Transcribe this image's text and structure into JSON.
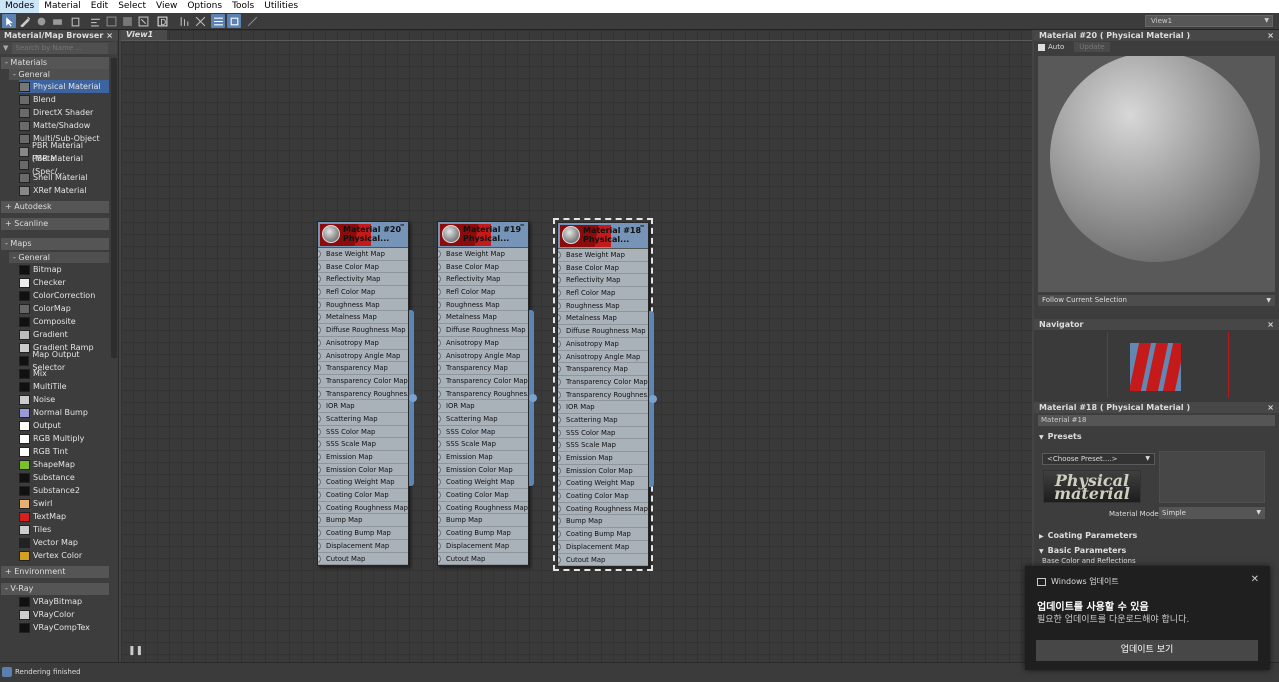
{
  "menubar": {
    "items": [
      "Modes",
      "Material",
      "Edit",
      "Select",
      "View",
      "Options",
      "Tools",
      "Utilities"
    ]
  },
  "toolbar": {
    "view_dropdown": "View1"
  },
  "browser": {
    "title": "Material/Map Browser",
    "search_placeholder": "Search by Name ...",
    "materials_label": "- Materials",
    "general_label": "- General",
    "materials": [
      {
        "label": "Physical Material",
        "color": "#777"
      },
      {
        "label": "Blend",
        "color": "#6a6a6a"
      },
      {
        "label": "DirectX Shader",
        "color": "#6a6a6a"
      },
      {
        "label": "Matte/Shadow",
        "color": "#6a6a6a"
      },
      {
        "label": "Multi/Sub-Object",
        "color": "#6a6a6a"
      },
      {
        "label": "PBR Material (Metal...",
        "color": "#888"
      },
      {
        "label": "PBR Material (Spec/...",
        "color": "#6a6a6a"
      },
      {
        "label": "Shell Material",
        "color": "#6a6a6a"
      },
      {
        "label": "XRef Material",
        "color": "#888"
      }
    ],
    "autodesk_label": "+ Autodesk",
    "scanline_label": "+ Scanline",
    "maps_label": "- Maps",
    "maps_general_label": "- General",
    "maps": [
      {
        "label": "Bitmap",
        "color": "#111"
      },
      {
        "label": "Checker",
        "color": "#eee"
      },
      {
        "label": "ColorCorrection",
        "color": "#111"
      },
      {
        "label": "ColorMap",
        "color": "#666"
      },
      {
        "label": "Composite",
        "color": "#111"
      },
      {
        "label": "Gradient",
        "color": "#bbb"
      },
      {
        "label": "Gradient Ramp",
        "color": "#ccc"
      },
      {
        "label": "Map Output Selector",
        "color": "#111"
      },
      {
        "label": "Mix",
        "color": "#111"
      },
      {
        "label": "MultiTile",
        "color": "#111"
      },
      {
        "label": "Noise",
        "color": "#ccc"
      },
      {
        "label": "Normal Bump",
        "color": "#9a9adb"
      },
      {
        "label": "Output",
        "color": "#fff"
      },
      {
        "label": "RGB Multiply",
        "color": "#fff"
      },
      {
        "label": "RGB Tint",
        "color": "#fff"
      },
      {
        "label": "ShapeMap",
        "color": "#7bbf2a"
      },
      {
        "label": "Substance",
        "color": "#111"
      },
      {
        "label": "Substance2",
        "color": "#111"
      },
      {
        "label": "Swirl",
        "color": "#e8b070"
      },
      {
        "label": "TextMap",
        "color": "#d52020"
      },
      {
        "label": "Tiles",
        "color": "#ccc"
      },
      {
        "label": "Vector Map",
        "color": "#222"
      },
      {
        "label": "Vertex Color",
        "color": "#d4a020"
      }
    ],
    "environment_label": "+ Environment",
    "vray_label": "- V-Ray",
    "vray": [
      {
        "label": "VRayBitmap",
        "color": "#111"
      },
      {
        "label": "VRayColor",
        "color": "#ccc"
      },
      {
        "label": "VRayCompTex",
        "color": "#111"
      }
    ]
  },
  "view": {
    "tab": "View1"
  },
  "slots": [
    "Base Weight Map",
    "Base Color Map",
    "Reflectivity Map",
    "Refl Color Map",
    "Roughness Map",
    "Metalness Map",
    "Diffuse Roughness Map",
    "Anisotropy Map",
    "Anisotropy Angle Map",
    "Transparency Map",
    "Transparency Color Map",
    "Transparency Roughnes...",
    "IOR Map",
    "Scattering Map",
    "SSS Color Map",
    "SSS Scale Map",
    "Emission Map",
    "Emission Color Map",
    "Coating Weight Map",
    "Coating Color Map",
    "Coating Roughness Map",
    "Bump Map",
    "Coating Bump Map",
    "Displacement Map",
    "Cutout Map"
  ],
  "nodes": [
    {
      "title": "Material #20",
      "subtitle": "Physical..."
    },
    {
      "title": "Material #19",
      "subtitle": "Physical..."
    },
    {
      "title": "Material #18",
      "subtitle": "Physical..."
    }
  ],
  "preview": {
    "title": "Material #20  ( Physical Material )",
    "auto": "Auto",
    "update": "Update",
    "follow": "Follow Current Selection"
  },
  "navigator": {
    "title": "Navigator"
  },
  "params": {
    "title": "Material #18  ( Physical Material )",
    "name": "Material #18",
    "presets": "Presets",
    "choose_preset": "<Choose Preset....>",
    "logo": "Physical material",
    "material_mode_label": "Material Mode:",
    "material_mode": "Simple",
    "coating": "Coating Parameters",
    "basic": "Basic Parameters",
    "base_color": "Base Color and Reflections"
  },
  "status": {
    "text": "Rendering finished"
  },
  "toast": {
    "app": "Windows 업데이트",
    "title": "업데이트를 사용할 수 있음",
    "body": "필요한 업데이트를 다운로드해야 합니다.",
    "button": "업데이트 보기"
  }
}
